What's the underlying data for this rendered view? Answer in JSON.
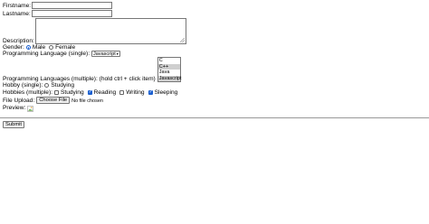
{
  "form": {
    "firstname_label": "Firstname:",
    "firstname_value": "",
    "lastname_label": "Lastname:",
    "lastname_value": "",
    "description_label": "Description:",
    "description_value": "",
    "gender_label": "Gender:",
    "gender_options": [
      {
        "label": "Male",
        "checked": true
      },
      {
        "label": "Female",
        "checked": false
      }
    ],
    "lang_single_label": "Programming Language (single):",
    "lang_single_selected": "Javascript",
    "lang_multi_label": "Programming Languages (multiple): (hold ctrl + click item)",
    "lang_multi_options": [
      {
        "label": "C",
        "selected": false
      },
      {
        "label": "C++",
        "selected": true
      },
      {
        "label": "Java",
        "selected": false
      },
      {
        "label": "Javascript",
        "selected": true
      }
    ],
    "hobby_single_label": "Hobby (single):",
    "hobby_single_option": "Studying",
    "hobbies_multi_label": "Hobbies (multiple):",
    "hobbies_multi_options": [
      {
        "label": "Studying",
        "checked": false
      },
      {
        "label": "Reading",
        "checked": true
      },
      {
        "label": "Writing",
        "checked": false
      },
      {
        "label": "Sleeping",
        "checked": true
      }
    ],
    "file_label": "File Upload:",
    "file_button": "Choose File",
    "file_status": "No file chosen",
    "preview_label": "Preview:",
    "submit_label": "Submit"
  },
  "colors": {
    "accent": "#1a5fd0",
    "selected_option": "#cfcfcf",
    "border": "#777777"
  },
  "icons": {
    "preview": "broken-image-icon",
    "select_caret": "chevron-down-icon"
  }
}
